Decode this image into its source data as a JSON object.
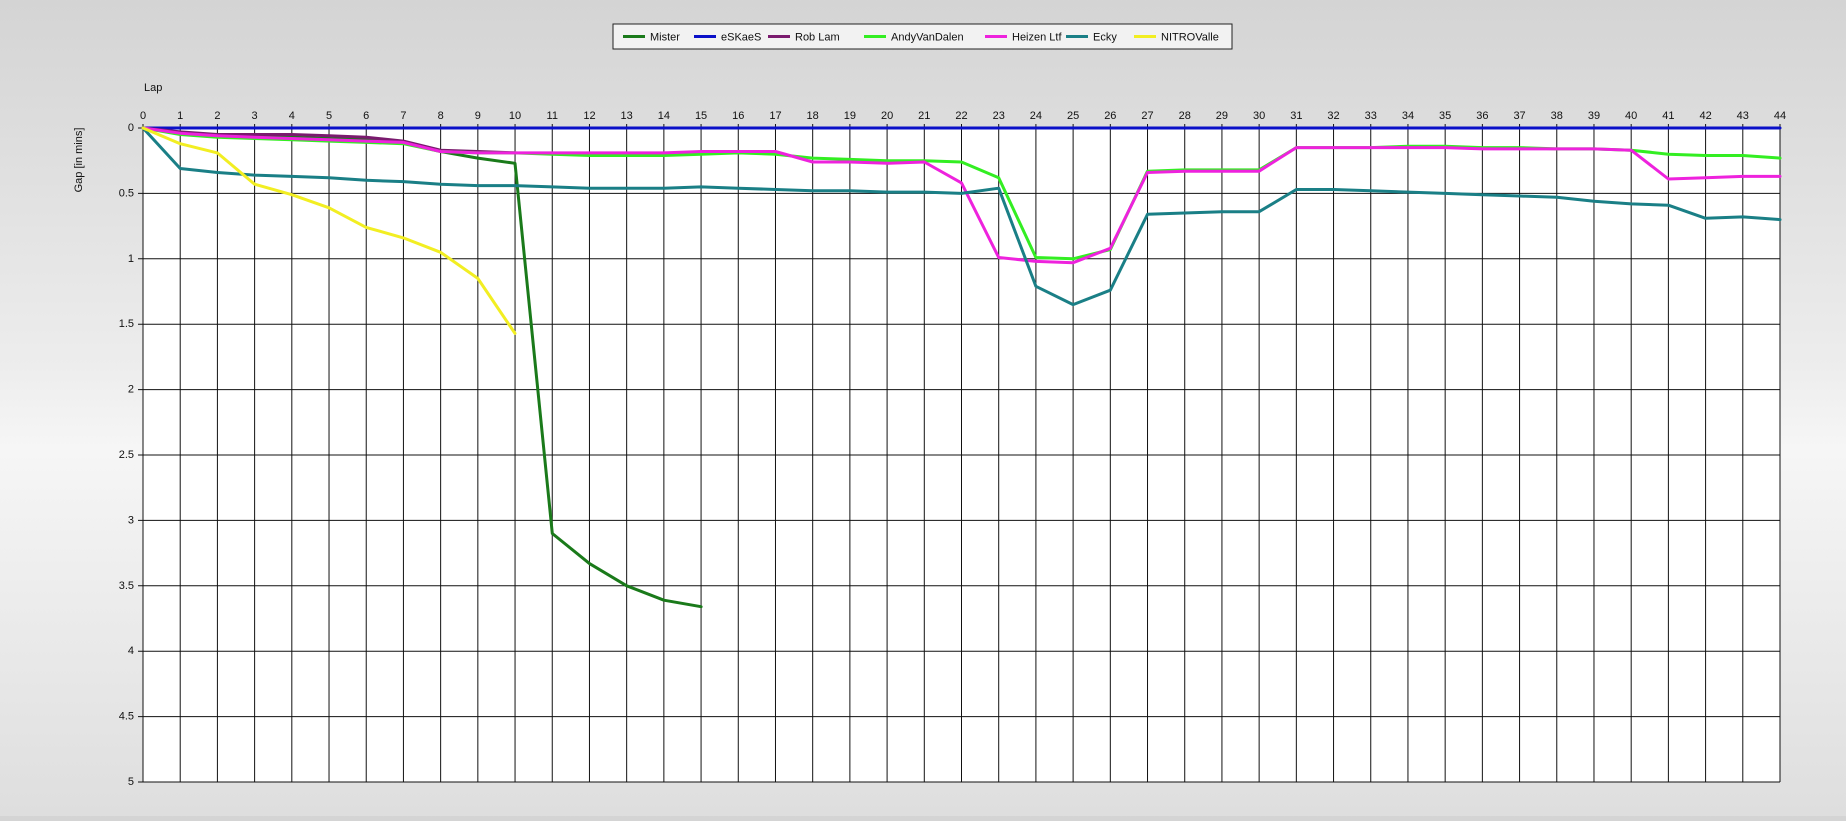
{
  "chart_data": {
    "type": "line",
    "xlabel": "Lap",
    "ylabel": "Gap [in mins]",
    "xlim": [
      0,
      44
    ],
    "ylim": [
      0,
      5
    ],
    "y_inverted": true,
    "grid": true,
    "legend_position": "top-center",
    "x_ticks": [
      "0",
      "1",
      "2",
      "3",
      "4",
      "5",
      "6",
      "7",
      "8",
      "9",
      "10",
      "11",
      "12",
      "13",
      "14",
      "15",
      "16",
      "17",
      "18",
      "19",
      "20",
      "21",
      "22",
      "23",
      "24",
      "25",
      "26",
      "27",
      "28",
      "29",
      "30",
      "31",
      "32",
      "33",
      "34",
      "35",
      "36",
      "37",
      "38",
      "39",
      "40",
      "41",
      "42",
      "43",
      "44"
    ],
    "y_ticks": [
      "0",
      "0.5",
      "1",
      "1.5",
      "2",
      "2.5",
      "3",
      "3.5",
      "4",
      "4.5",
      "5"
    ],
    "series": [
      {
        "name": "Mister",
        "color": "#1a7a1a",
        "x": [
          0,
          1,
          2,
          3,
          4,
          5,
          6,
          7,
          8,
          9,
          10,
          11,
          12,
          13,
          14,
          15
        ],
        "values": [
          0,
          0.04,
          0.06,
          0.07,
          0.07,
          0.08,
          0.09,
          0.11,
          0.18,
          0.23,
          0.27,
          3.1,
          3.33,
          3.5,
          3.61,
          3.66
        ]
      },
      {
        "name": "eSKaeS",
        "color": "#0a10c8",
        "x": [
          0,
          1,
          2,
          3,
          4,
          5,
          6,
          7,
          8,
          9,
          10,
          11,
          12,
          13,
          14,
          15,
          16,
          17,
          18,
          19,
          20,
          21,
          22,
          23,
          24,
          25,
          26,
          27,
          28,
          29,
          30,
          31,
          32,
          33,
          34,
          35,
          36,
          37,
          38,
          39,
          40,
          41,
          42,
          43,
          44
        ],
        "values": [
          0,
          0,
          0,
          0,
          0,
          0,
          0,
          0,
          0,
          0,
          0,
          0,
          0,
          0,
          0,
          0,
          0,
          0,
          0,
          0,
          0,
          0,
          0,
          0,
          0,
          0,
          0,
          0,
          0,
          0,
          0,
          0,
          0,
          0,
          0,
          0,
          0,
          0,
          0,
          0,
          0,
          0,
          0,
          0,
          0
        ]
      },
      {
        "name": "Rob Lam",
        "color": "#7a1a6e",
        "x": [
          0,
          1,
          2,
          3,
          4,
          5,
          6,
          7,
          8,
          9,
          10
        ],
        "values": [
          0,
          0.03,
          0.05,
          0.05,
          0.05,
          0.06,
          0.07,
          0.1,
          0.17,
          0.18,
          0.19
        ]
      },
      {
        "name": "AndyVanDalen",
        "color": "#33ee22",
        "x": [
          0,
          1,
          2,
          3,
          4,
          5,
          6,
          7,
          8,
          9,
          10,
          11,
          12,
          13,
          14,
          15,
          16,
          17,
          18,
          19,
          20,
          21,
          22,
          23,
          24,
          25,
          26,
          27,
          28,
          29,
          30,
          31,
          32,
          33,
          34,
          35,
          36,
          37,
          38,
          39,
          40,
          41,
          42,
          43,
          44
        ],
        "values": [
          0,
          0.05,
          0.07,
          0.08,
          0.09,
          0.1,
          0.11,
          0.12,
          0.18,
          0.19,
          0.19,
          0.2,
          0.21,
          0.21,
          0.21,
          0.2,
          0.19,
          0.2,
          0.23,
          0.24,
          0.25,
          0.25,
          0.26,
          0.38,
          0.99,
          1.0,
          0.93,
          0.33,
          0.32,
          0.32,
          0.32,
          0.15,
          0.15,
          0.15,
          0.14,
          0.14,
          0.15,
          0.15,
          0.16,
          0.16,
          0.17,
          0.2,
          0.21,
          0.21,
          0.23
        ]
      },
      {
        "name": "Heizen Ltf",
        "color": "#ee22dd",
        "x": [
          0,
          1,
          2,
          3,
          4,
          5,
          6,
          7,
          8,
          9,
          10,
          11,
          12,
          13,
          14,
          15,
          16,
          17,
          18,
          19,
          20,
          21,
          22,
          23,
          24,
          25,
          26,
          27,
          28,
          29,
          30,
          31,
          32,
          33,
          34,
          35,
          36,
          37,
          38,
          39,
          40,
          41,
          42,
          43,
          44
        ],
        "values": [
          0,
          0.04,
          0.06,
          0.07,
          0.08,
          0.09,
          0.1,
          0.11,
          0.18,
          0.19,
          0.19,
          0.19,
          0.19,
          0.19,
          0.19,
          0.18,
          0.18,
          0.18,
          0.26,
          0.26,
          0.27,
          0.26,
          0.42,
          0.99,
          1.02,
          1.03,
          0.92,
          0.34,
          0.33,
          0.33,
          0.33,
          0.15,
          0.15,
          0.15,
          0.15,
          0.15,
          0.16,
          0.16,
          0.16,
          0.16,
          0.17,
          0.39,
          0.38,
          0.37,
          0.37
        ]
      },
      {
        "name": "Ecky",
        "color": "#1a7f86",
        "x": [
          0,
          1,
          2,
          3,
          4,
          5,
          6,
          7,
          8,
          9,
          10,
          11,
          12,
          13,
          14,
          15,
          16,
          17,
          18,
          19,
          20,
          21,
          22,
          23,
          24,
          25,
          26,
          27,
          28,
          29,
          30,
          31,
          32,
          33,
          34,
          35,
          36,
          37,
          38,
          39,
          40,
          41,
          42,
          43,
          44
        ],
        "values": [
          0,
          0.31,
          0.34,
          0.36,
          0.37,
          0.38,
          0.4,
          0.41,
          0.43,
          0.44,
          0.44,
          0.45,
          0.46,
          0.46,
          0.46,
          0.45,
          0.46,
          0.47,
          0.48,
          0.48,
          0.49,
          0.49,
          0.5,
          0.46,
          1.21,
          1.35,
          1.24,
          0.66,
          0.65,
          0.64,
          0.64,
          0.47,
          0.47,
          0.48,
          0.49,
          0.5,
          0.51,
          0.52,
          0.53,
          0.56,
          0.58,
          0.59,
          0.69,
          0.68,
          0.7
        ]
      },
      {
        "name": "NITROValle",
        "color": "#f2ee22",
        "x": [
          0,
          1,
          2,
          3,
          4,
          5,
          6,
          7,
          8,
          9,
          10
        ],
        "values": [
          0,
          0.12,
          0.19,
          0.43,
          0.51,
          0.61,
          0.76,
          0.84,
          0.95,
          1.15,
          1.57
        ]
      }
    ]
  }
}
